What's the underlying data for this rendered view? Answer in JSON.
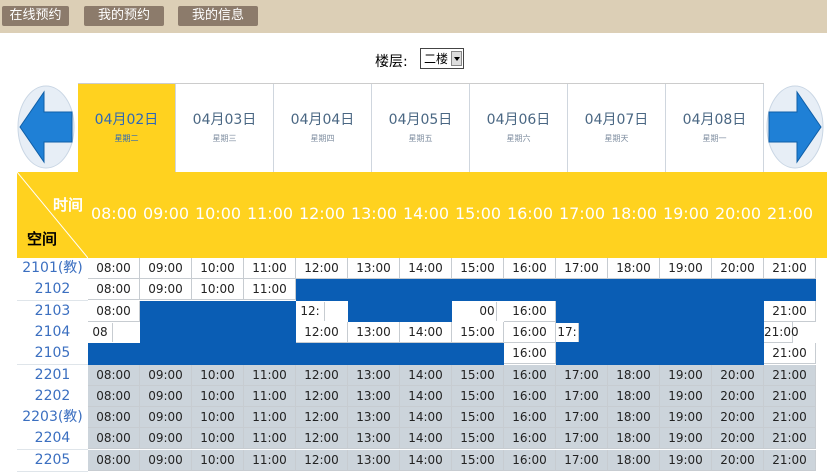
{
  "nav": {
    "items": [
      "在线预约",
      "我的预约",
      "我的信息"
    ]
  },
  "floor": {
    "label": "楼层:",
    "selected": "二楼"
  },
  "dates": [
    {
      "date": "04月02日",
      "day": "星期二",
      "active": true
    },
    {
      "date": "04月03日",
      "day": "星期三",
      "active": false
    },
    {
      "date": "04月04日",
      "day": "星期四",
      "active": false
    },
    {
      "date": "04月05日",
      "day": "星期五",
      "active": false
    },
    {
      "date": "04月06日",
      "day": "星期六",
      "active": false
    },
    {
      "date": "04月07日",
      "day": "星期天",
      "active": false
    },
    {
      "date": "04月08日",
      "day": "星期一",
      "active": false
    }
  ],
  "grid": {
    "time_label": "时间",
    "space_label": "空间",
    "hours": [
      "08:00",
      "09:00",
      "10:00",
      "11:00",
      "12:00",
      "13:00",
      "14:00",
      "15:00",
      "16:00",
      "17:00",
      "18:00",
      "19:00",
      "20:00",
      "21:00"
    ],
    "rooms": [
      "2101(教)",
      "2102",
      "2103",
      "2104",
      "2105",
      "2201",
      "2202",
      "2203(教)",
      "2204",
      "2205"
    ],
    "cells": [
      [
        "08:00",
        "09:00",
        "10:00",
        "11:00",
        "12:00",
        "13:00",
        "14:00",
        "15:00",
        "16:00",
        "17:00",
        "18:00",
        "19:00",
        "20:00",
        "21:00"
      ],
      [
        "08:00",
        "09:00",
        "10:00",
        "11:00",
        "",
        "",
        "",
        "",
        "",
        "",
        "",
        "",
        "",
        ""
      ],
      [
        "08:00",
        "",
        "",
        "",
        "12:",
        "",
        "",
        "00",
        "16:00",
        "",
        "",
        "",
        "",
        "21:00"
      ],
      [
        "08",
        "",
        "",
        "",
        "12:00",
        "13:00",
        "14:00",
        "15:00",
        "16:00",
        "17:",
        "",
        "",
        "",
        "21:00"
      ],
      [
        "",
        "",
        "",
        "",
        "",
        "",
        "",
        "",
        "16:00",
        "",
        "",
        "",
        "",
        "21:00"
      ],
      [
        "08:00",
        "09:00",
        "10:00",
        "11:00",
        "12:00",
        "13:00",
        "14:00",
        "15:00",
        "16:00",
        "17:00",
        "18:00",
        "19:00",
        "20:00",
        "21:00"
      ],
      [
        "08:00",
        "09:00",
        "10:00",
        "11:00",
        "12:00",
        "13:00",
        "14:00",
        "15:00",
        "16:00",
        "17:00",
        "18:00",
        "19:00",
        "20:00",
        "21:00"
      ],
      [
        "08:00",
        "09:00",
        "10:00",
        "11:00",
        "12:00",
        "13:00",
        "14:00",
        "15:00",
        "16:00",
        "17:00",
        "18:00",
        "19:00",
        "20:00",
        "21:00"
      ],
      [
        "08:00",
        "09:00",
        "10:00",
        "11:00",
        "12:00",
        "13:00",
        "14:00",
        "15:00",
        "16:00",
        "17:00",
        "18:00",
        "19:00",
        "20:00",
        "21:00"
      ],
      [
        "08:00",
        "09:00",
        "10:00",
        "11:00",
        "12:00",
        "13:00",
        "14:00",
        "15:00",
        "16:00",
        "17:00",
        "18:00",
        "19:00",
        "20:00",
        "21:00"
      ]
    ]
  },
  "colors": {
    "highlight": "#ffd21f",
    "booked": "#0a5db4",
    "topbar": "#dccfb6",
    "nav_button": "#8c7b6b",
    "arrow": "#1f80d6"
  }
}
